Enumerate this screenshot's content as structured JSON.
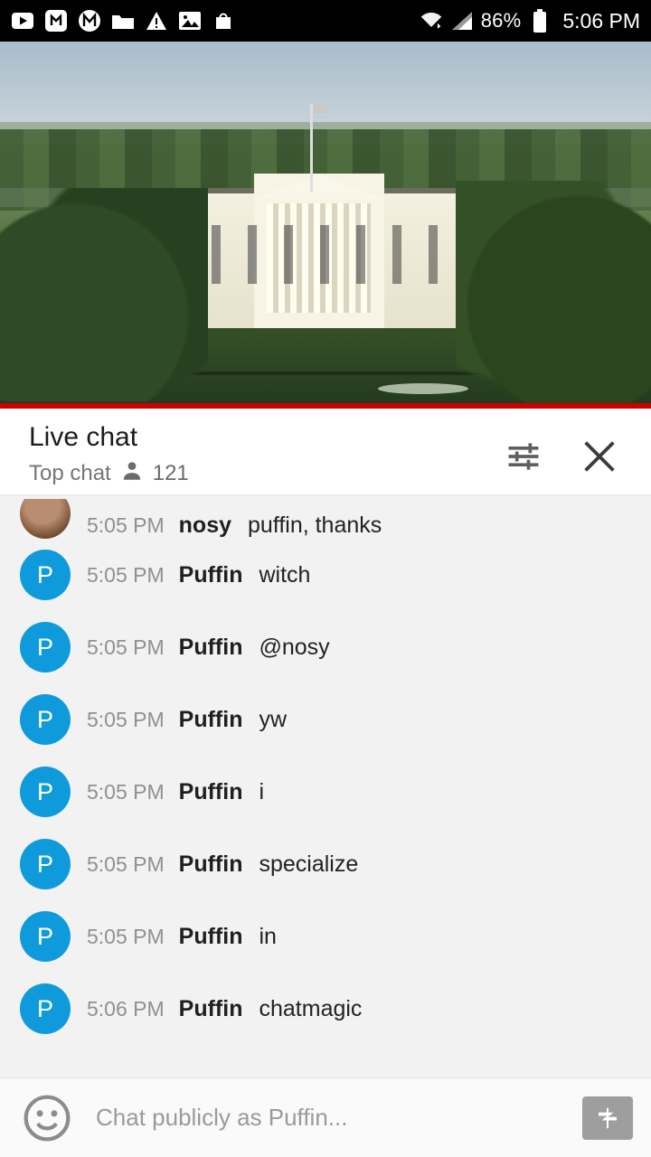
{
  "status_bar": {
    "icons": [
      "youtube-icon",
      "music-app-icon",
      "m-app-icon",
      "folder-icon",
      "warning-icon",
      "image-icon",
      "bag-icon"
    ],
    "wifi_icon": "wifi-icon",
    "signal_icon": "cellular-signal-icon",
    "battery_level": "86%",
    "battery_icon": "battery-icon",
    "clock": "5:06 PM"
  },
  "video": {
    "scene_description": "White House live stream",
    "progress_color": "#cc0000"
  },
  "chat_header": {
    "title": "Live chat",
    "subtitle": "Top chat",
    "viewer_icon": "person-icon",
    "viewer_count": "121",
    "settings_icon": "chat-settings-icon",
    "close_icon": "close-icon"
  },
  "messages": [
    {
      "time": "5:05 PM",
      "author": "nosy",
      "text": "puffin, thanks",
      "avatar": "photo",
      "avatar_letter": ""
    },
    {
      "time": "5:05 PM",
      "author": "Puffin",
      "text": "witch",
      "avatar": "p",
      "avatar_letter": "P"
    },
    {
      "time": "5:05 PM",
      "author": "Puffin",
      "text": "@nosy",
      "avatar": "p",
      "avatar_letter": "P"
    },
    {
      "time": "5:05 PM",
      "author": "Puffin",
      "text": "yw",
      "avatar": "p",
      "avatar_letter": "P"
    },
    {
      "time": "5:05 PM",
      "author": "Puffin",
      "text": "i",
      "avatar": "p",
      "avatar_letter": "P"
    },
    {
      "time": "5:05 PM",
      "author": "Puffin",
      "text": "specialize",
      "avatar": "p",
      "avatar_letter": "P"
    },
    {
      "time": "5:05 PM",
      "author": "Puffin",
      "text": "in",
      "avatar": "p",
      "avatar_letter": "P"
    },
    {
      "time": "5:06 PM",
      "author": "Puffin",
      "text": "chatmagic",
      "avatar": "p",
      "avatar_letter": "P"
    }
  ],
  "composer": {
    "emoji_icon": "emoji-face-icon",
    "placeholder": "Chat publicly as Puffin...",
    "value": "",
    "send_icon": "super-chat-icon"
  },
  "colors": {
    "accent": "#0f9bdb",
    "progress": "#cc0000",
    "chat_bg": "#f2f2f2"
  }
}
